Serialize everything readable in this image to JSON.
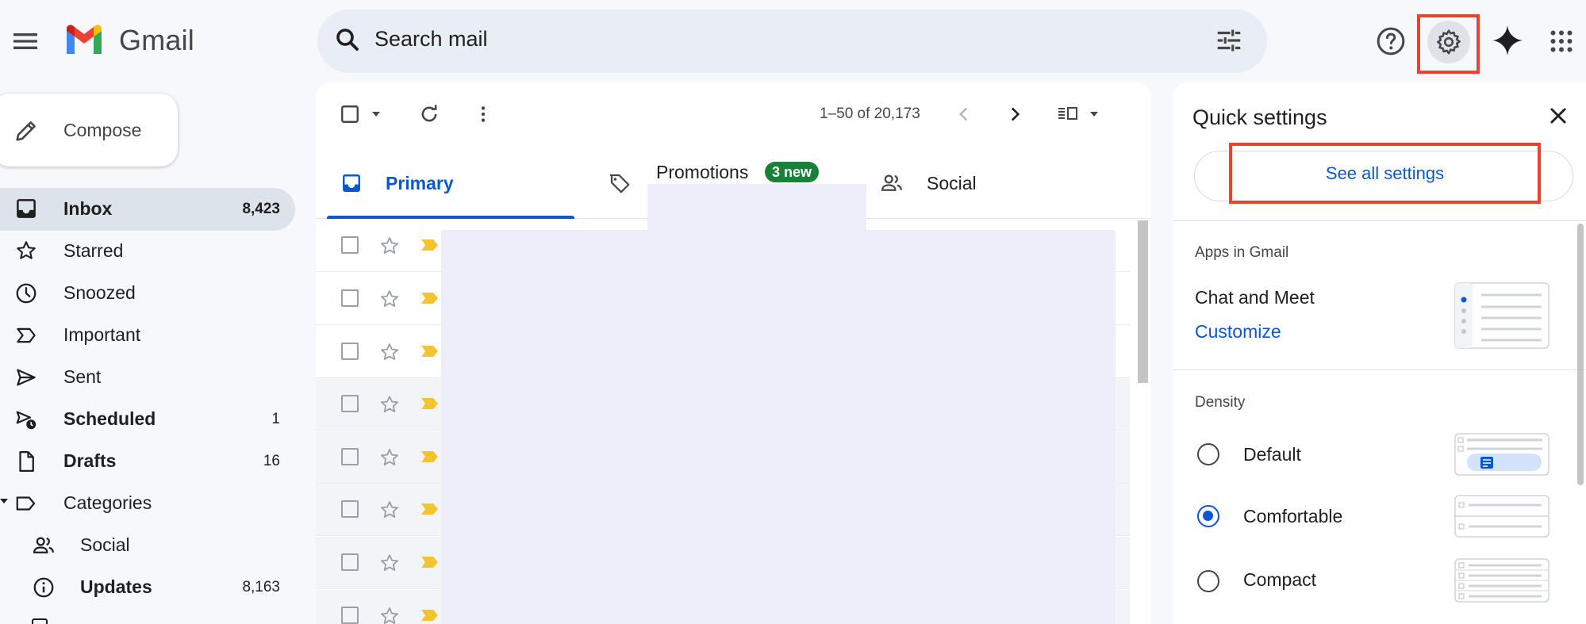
{
  "header": {
    "brand": "Gmail",
    "search_placeholder": "Search mail",
    "icons": [
      "menu-icon",
      "search-icon",
      "tune-icon",
      "help-icon",
      "settings-icon",
      "gemini-icon",
      "apps-icon"
    ]
  },
  "compose": {
    "label": "Compose"
  },
  "sidebar": {
    "items": [
      {
        "label": "Inbox",
        "count": "8,423",
        "icon": "inbox-icon",
        "bold": true,
        "active": true
      },
      {
        "label": "Starred",
        "count": "",
        "icon": "star-icon"
      },
      {
        "label": "Snoozed",
        "count": "",
        "icon": "clock-icon"
      },
      {
        "label": "Important",
        "count": "",
        "icon": "important-icon"
      },
      {
        "label": "Sent",
        "count": "",
        "icon": "send-icon"
      },
      {
        "label": "Scheduled",
        "count": "1",
        "icon": "scheduled-icon",
        "bold": true
      },
      {
        "label": "Drafts",
        "count": "16",
        "icon": "draft-icon",
        "bold": true
      },
      {
        "label": "Categories",
        "count": "",
        "icon": "label-icon"
      },
      {
        "label": "Social",
        "count": "",
        "icon": "people-icon"
      },
      {
        "label": "Updates",
        "count": "8,163",
        "icon": "info-icon",
        "bold": true
      }
    ]
  },
  "toolbar": {
    "pagination": "1–50 of 20,173"
  },
  "tabs": [
    {
      "label": "Primary",
      "active": true
    },
    {
      "label": "Promotions",
      "badge": "3 new"
    },
    {
      "label": "Social"
    }
  ],
  "quick_settings": {
    "title": "Quick settings",
    "see_all": "See all settings",
    "apps_heading": "Apps in Gmail",
    "chat_meet": "Chat and Meet",
    "customize": "Customize",
    "density_heading": "Density",
    "density_options": [
      {
        "label": "Default",
        "selected": false
      },
      {
        "label": "Comfortable",
        "selected": true
      },
      {
        "label": "Compact",
        "selected": false
      }
    ]
  },
  "colors": {
    "accent": "#0b57d0",
    "highlight_box": "#e8432d",
    "badge_green": "#188038",
    "important_marker": "#f4c430",
    "redaction": "#eeeefb"
  }
}
